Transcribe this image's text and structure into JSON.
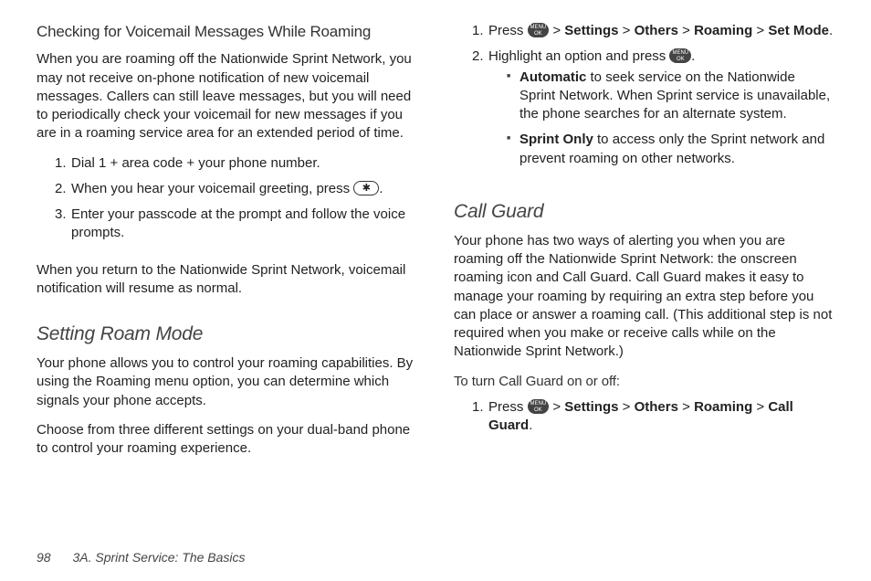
{
  "left": {
    "heading1": "Checking for Voicemail Messages While Roaming",
    "para1": "When you are roaming off the Nationwide Sprint Network, you may not receive on-phone notification of new voicemail messages. Callers can still leave messages, but you will need to periodically check your voicemail for new messages if you are in a roaming service area for an extended period of time.",
    "steps1": {
      "s1": "Dial 1 + area code + your phone number.",
      "s2a": "When you hear your voicemail greeting, press ",
      "s2b": ".",
      "s3": "Enter your passcode at the prompt and follow the voice prompts."
    },
    "para2": "When you return to the Nationwide Sprint Network, voicemail notification will resume as normal.",
    "heading2": "Setting Roam Mode",
    "para3": "Your phone allows you to control your roaming capabilities. By using the Roaming menu option, you can determine which signals your phone accepts.",
    "para4": "Choose from three different settings on your dual-band phone to control your roaming experience."
  },
  "right": {
    "steps1": {
      "s1a": "Press ",
      "s1_gt1": " > ",
      "s1_settings": "Settings",
      "s1_gt2": " > ",
      "s1_others": "Others",
      "s1_gt3": " > ",
      "s1_roaming": "Roaming",
      "s1_gt4": " > ",
      "s1_setmode": "Set Mode",
      "s1_end": ".",
      "s2a": "Highlight an option and press ",
      "s2b": ".",
      "sub1_bold": "Automatic",
      "sub1_rest": " to seek service on the Nationwide Sprint Network. When Sprint service is unavailable, the phone searches for an alternate system.",
      "sub2_bold": "Sprint Only",
      "sub2_rest": " to access only the Sprint network and prevent roaming on other networks."
    },
    "heading1": "Call Guard",
    "para1": "Your phone has two ways of alerting you when you are roaming off the Nationwide Sprint Network: the onscreen roaming icon and Call Guard. Call Guard makes it easy to manage your roaming by requiring an extra step before you can place or answer a roaming call. (This additional step is not required when you make or receive calls while on the Nationwide Sprint Network.)",
    "lead1": "To turn Call Guard on or off:",
    "steps2": {
      "s1a": "Press ",
      "s1_gt1": " > ",
      "s1_settings": "Settings",
      "s1_gt2": " > ",
      "s1_others": "Others",
      "s1_gt3": " > ",
      "s1_roaming": "Roaming",
      "s1_gt4": " > ",
      "s1_cg": "Call Guard",
      "s1_end": "."
    }
  },
  "footer": {
    "page": "98",
    "section": "3A. Sprint Service: The Basics"
  },
  "keys": {
    "star": "✱",
    "menu_l1": "MENU",
    "menu_l2": "OK"
  }
}
